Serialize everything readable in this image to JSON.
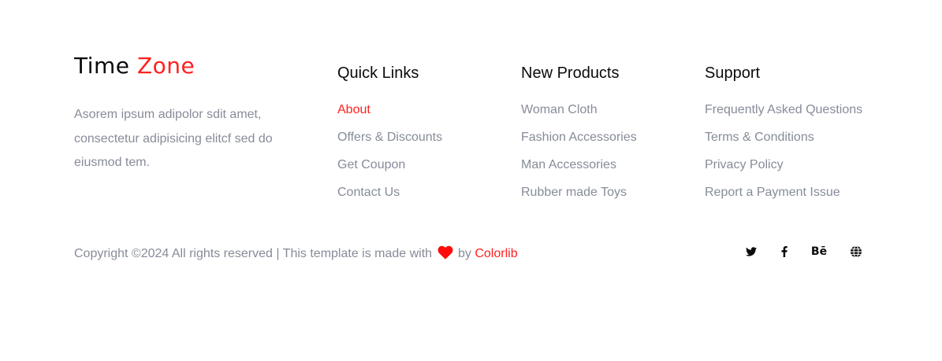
{
  "brand": {
    "word1": "Time",
    "word2": "Zone",
    "description": "Asorem ipsum adipolor sdit amet, consectetur adipisicing elitcf sed do eiusmod tem."
  },
  "columns": [
    {
      "title": "Quick Links",
      "items": [
        "About",
        "Offers & Discounts",
        "Get Coupon",
        "Contact Us"
      ]
    },
    {
      "title": "New Products",
      "items": [
        "Woman Cloth",
        "Fashion Accessories",
        "Man Accessories",
        "Rubber made Toys"
      ]
    },
    {
      "title": "Support",
      "items": [
        "Frequently Asked Questions",
        "Terms & Conditions",
        "Privacy Policy",
        "Report a Payment Issue"
      ]
    }
  ],
  "copyright": {
    "prefix": "Copyright ©2024 All rights reserved | This template is made with",
    "by": "by",
    "link": "Colorlib",
    "icon": "heart-icon"
  },
  "social": {
    "twitter_icon": "twitter-icon",
    "facebook_icon": "facebook-icon",
    "behance_label": "Bē",
    "globe_icon": "globe-icon"
  },
  "colors": {
    "accent": "#ff2020",
    "text_muted": "#868c98",
    "heading": "#0b0b0b"
  }
}
